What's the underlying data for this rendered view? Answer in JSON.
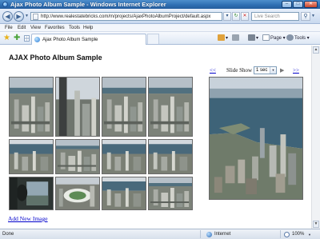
{
  "window": {
    "title": "Ajax Photo Album Sample - Windows Internet Explorer",
    "minimize_glyph": "–",
    "maximize_glyph": "□",
    "close_glyph": "✕"
  },
  "address_bar": {
    "back_glyph": "◀",
    "forward_glyph": "▶",
    "url": "http://www.realestatebricks.com/m/projects/AjaxPhotoAlbumProject/default.aspx",
    "search_placeholder": "Live Search"
  },
  "menu": [
    "File",
    "Edit",
    "View",
    "Favorites",
    "Tools",
    "Help"
  ],
  "tabs": [
    {
      "label": "Ajax Photo Album Sample"
    }
  ],
  "toolbar": {
    "page_label": "Page ▾",
    "tools_label": "Tools ▾"
  },
  "page": {
    "title": "AJAX Photo Album Sample",
    "add_link": "Add New Image"
  },
  "slideshow": {
    "prev_label": "<<",
    "next_label": ">>",
    "label": "Slide Show",
    "interval_value": "1 sec"
  },
  "thumbnails": [
    {
      "scene": "aerial-city"
    },
    {
      "scene": "tower-view"
    },
    {
      "scene": "aerial-city"
    },
    {
      "scene": "aerial-city"
    },
    {
      "scene": "harbor-view"
    },
    {
      "scene": "aerial-city"
    },
    {
      "scene": "harbor-view"
    },
    {
      "scene": "harbor-view"
    },
    {
      "scene": "window-silhouette"
    },
    {
      "scene": "stadium-view"
    },
    {
      "scene": "harbor-view"
    },
    {
      "scene": "aerial-city"
    }
  ],
  "status": {
    "text": "Done",
    "zone": "Internet",
    "zoom": "100%"
  },
  "colors": {
    "link": "#0000cc",
    "title_bar": "#2e6db1",
    "sky": "#cfd6dd",
    "water": "#3e6378"
  }
}
